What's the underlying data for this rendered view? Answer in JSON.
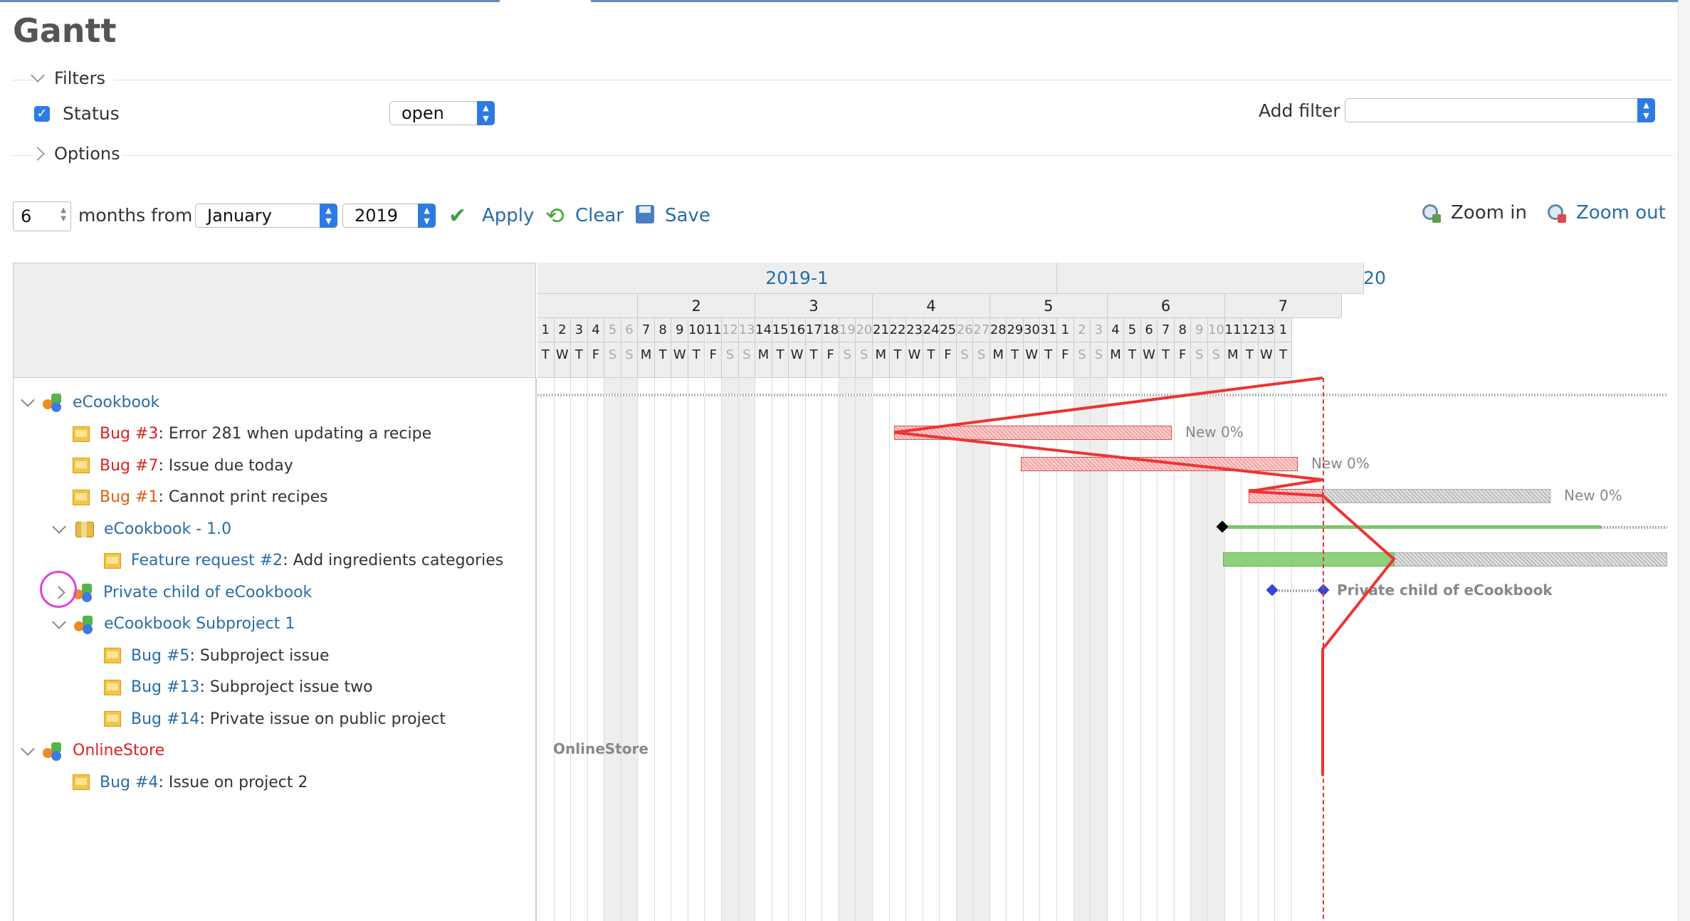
{
  "title": "Gantt",
  "filters": {
    "legend": "Filters",
    "status_label": "Status",
    "status_value": "open",
    "add_filter_label": "Add filter",
    "add_filter_value": ""
  },
  "options": {
    "legend": "Options"
  },
  "query": {
    "months": "6",
    "months_from_label": "months from",
    "month_value": "January",
    "year_value": "2019",
    "apply_label": "Apply",
    "clear_label": "Clear",
    "save_label": "Save",
    "zoom_in_label": "Zoom in",
    "zoom_out_label": "Zoom out"
  },
  "gantt": {
    "month_label": "2019-1",
    "next_month_label": "20",
    "weeks": [
      "2",
      "3",
      "4",
      "5",
      "6",
      "7"
    ],
    "days": [
      "1",
      "2",
      "3",
      "4",
      "5",
      "6",
      "7",
      "8",
      "9",
      "10",
      "11",
      "12",
      "13",
      "14",
      "15",
      "16",
      "17",
      "18",
      "19",
      "20",
      "21",
      "22",
      "23",
      "24",
      "25",
      "26",
      "27",
      "28",
      "29",
      "30",
      "31",
      "1",
      "2",
      "3",
      "4",
      "5",
      "6",
      "7",
      "8",
      "9",
      "10",
      "11",
      "12",
      "13",
      "1"
    ],
    "weekdays": [
      "T",
      "W",
      "T",
      "F",
      "S",
      "S",
      "M",
      "T",
      "W",
      "T",
      "F",
      "S",
      "S",
      "M",
      "T",
      "W",
      "T",
      "F",
      "S",
      "S",
      "M",
      "T",
      "W",
      "T",
      "F",
      "S",
      "S",
      "M",
      "T",
      "W",
      "T",
      "F",
      "S",
      "S",
      "M",
      "T",
      "W",
      "T",
      "F",
      "S",
      "S",
      "M",
      "T",
      "W",
      "T"
    ],
    "rows": [
      {
        "type": "project",
        "indent": 0,
        "toggle": "open",
        "prefix": "",
        "link": "eCookbook",
        "link_color": "blue",
        "suffix": ""
      },
      {
        "type": "issue",
        "indent": 1,
        "toggle": "",
        "prefix": "",
        "link": "Bug #3",
        "link_color": "red",
        "suffix": ": Error 281 when updating a recipe"
      },
      {
        "type": "issue",
        "indent": 1,
        "toggle": "",
        "prefix": "",
        "link": "Bug #7",
        "link_color": "red",
        "suffix": ": Issue due today"
      },
      {
        "type": "issue",
        "indent": 1,
        "toggle": "",
        "prefix": "",
        "link": "Bug #1",
        "link_color": "orange",
        "suffix": ": Cannot print recipes"
      },
      {
        "type": "version",
        "indent": 1,
        "toggle": "open",
        "prefix": "",
        "link": "eCookbook - 1.0",
        "link_color": "blue",
        "suffix": ""
      },
      {
        "type": "issue",
        "indent": 2,
        "toggle": "",
        "prefix": "",
        "link": "Feature request #2",
        "link_color": "blue",
        "suffix": ": Add ingredients categories"
      },
      {
        "type": "project",
        "indent": 1,
        "toggle": "closed",
        "prefix": "",
        "link": "Private child of eCookbook",
        "link_color": "blue",
        "suffix": ""
      },
      {
        "type": "project",
        "indent": 1,
        "toggle": "open",
        "prefix": "",
        "link": "eCookbook Subproject 1",
        "link_color": "blue",
        "suffix": ""
      },
      {
        "type": "issue",
        "indent": 2,
        "toggle": "",
        "prefix": "",
        "link": "Bug #5",
        "link_color": "blue",
        "suffix": ": Subproject issue"
      },
      {
        "type": "issue",
        "indent": 2,
        "toggle": "",
        "prefix": "",
        "link": "Bug #13",
        "link_color": "blue",
        "suffix": ": Subproject issue two"
      },
      {
        "type": "issue",
        "indent": 2,
        "toggle": "",
        "prefix": "",
        "link": "Bug #14",
        "link_color": "blue",
        "suffix": ": Private issue on public project"
      },
      {
        "type": "project",
        "indent": 0,
        "toggle": "open",
        "prefix": "",
        "link": "OnlineStore",
        "link_color": "red",
        "suffix": ""
      },
      {
        "type": "issue",
        "indent": 1,
        "toggle": "",
        "prefix": "",
        "link": "Bug #4",
        "link_color": "blue",
        "suffix": ": Issue on project 2"
      }
    ],
    "bar_labels": {
      "bug3": "New 0%",
      "bug7": "New 0%",
      "bug1": "New 0%",
      "private_child": "Private child of eCookbook",
      "online_store": "OnlineStore"
    }
  },
  "colors": {
    "accent": "#2a6ca6",
    "late": "#e02020",
    "done": "#55bb44",
    "highlight": "#e040e0"
  }
}
